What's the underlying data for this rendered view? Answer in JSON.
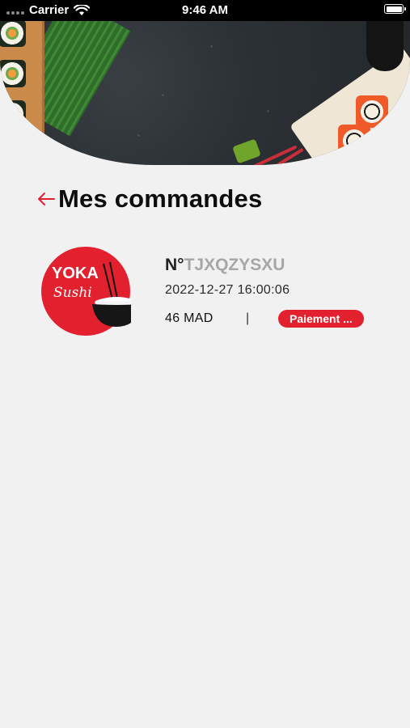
{
  "status_bar": {
    "carrier": "Carrier",
    "time": "9:46 AM"
  },
  "header": {
    "title": "Mes commandes"
  },
  "brand": {
    "logo_line1": "YOKA",
    "logo_line2": "Sushi",
    "accent_color": "#e3202d"
  },
  "orders": [
    {
      "number_prefix": "N°",
      "number_code": "TJXQZYSXU",
      "date": "2022-12-27 16:00:06",
      "price": "46 MAD",
      "separator": "|",
      "status": "Paiement ..."
    }
  ],
  "icons": {
    "back": "arrow-left-icon",
    "wifi": "wifi-icon",
    "battery": "battery-icon",
    "signal": "signal-icon"
  }
}
